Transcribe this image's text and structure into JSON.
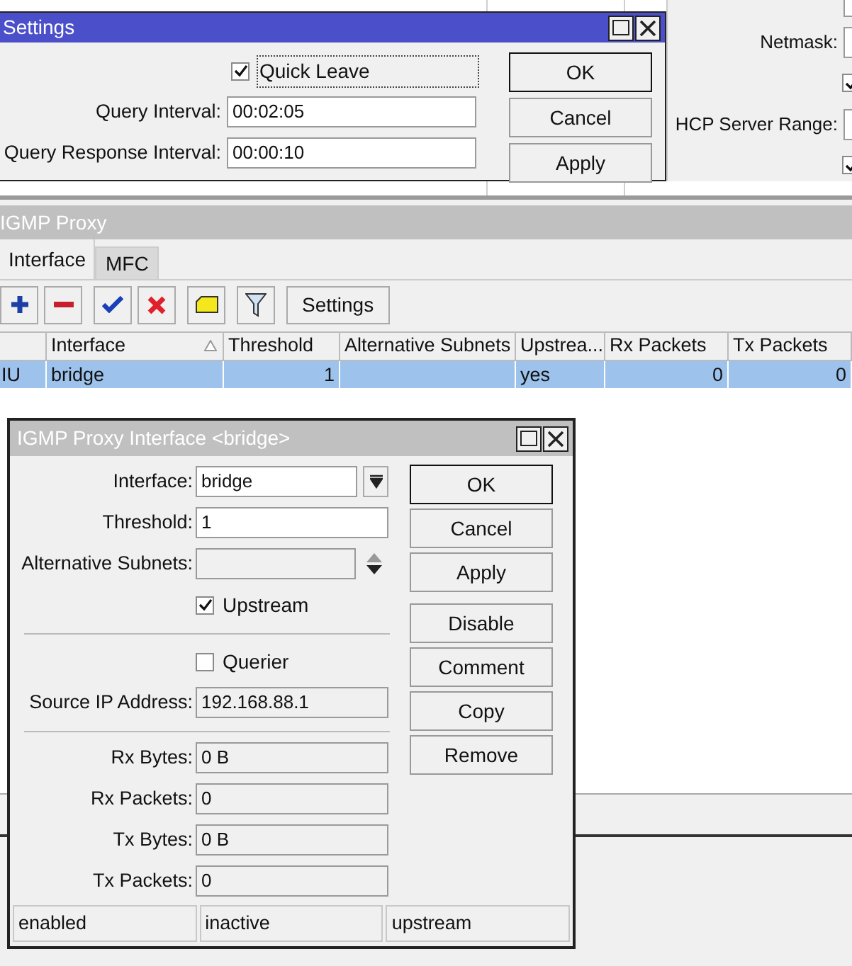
{
  "background_window": {
    "fields": [
      {
        "kind": "field"
      },
      {
        "label": "Netmask:"
      },
      {
        "kind": "checkbox",
        "checked": true
      },
      {
        "label": "HCP Server Range:"
      },
      {
        "kind": "checkbox",
        "checked": true
      }
    ]
  },
  "settings_window": {
    "title": "Settings",
    "quick_leave": {
      "label": "Quick Leave",
      "checked": true
    },
    "fields": [
      {
        "label": "Query Interval:",
        "value": "00:02:05"
      },
      {
        "label": "Query Response Interval:",
        "value": "00:00:10"
      }
    ],
    "buttons": [
      "OK",
      "Cancel",
      "Apply"
    ]
  },
  "igmp_proxy_window": {
    "title": "IGMP Proxy",
    "tabs": [
      {
        "label": "Interface",
        "selected": true
      },
      {
        "label": "MFC",
        "selected": false
      }
    ],
    "toolbar": [
      {
        "kind": "add"
      },
      {
        "kind": "remove"
      },
      {
        "kind": "enable"
      },
      {
        "kind": "disable"
      },
      {
        "kind": "comment"
      },
      {
        "kind": "filter"
      },
      {
        "kind": "text",
        "label": "Settings"
      }
    ],
    "table": {
      "columns": [
        {
          "label": "Interface",
          "sorted": true
        },
        {
          "label": "Threshold",
          "sorted": false
        },
        {
          "label": "Alternative Subnets",
          "sorted": false
        },
        {
          "label": "Upstrea...",
          "sorted": false
        },
        {
          "label": "Rx Packets",
          "sorted": false
        },
        {
          "label": "Tx Packets",
          "sorted": false
        }
      ],
      "rows": [
        {
          "selected": true,
          "flags": "IU",
          "interface": "bridge",
          "threshold": "1",
          "upstream": "yes",
          "rx_packets": "0",
          "tx_packets": "0"
        }
      ]
    }
  },
  "interface_dialog": {
    "title": "IGMP Proxy Interface <bridge>",
    "interface": {
      "label": "Interface:",
      "value": "bridge"
    },
    "threshold": {
      "label": "Threshold:",
      "value": "1"
    },
    "alternative_subnets": {
      "label": "Alternative Subnets:",
      "disabled": true
    },
    "upstream": {
      "label": "Upstream",
      "checked": true
    },
    "querier": {
      "label": "Querier",
      "checked": false
    },
    "source_ip": {
      "label": "Source IP Address:",
      "value": "192.168.88.1"
    },
    "stats": [
      {
        "label": "Rx Bytes:",
        "value": "0 B"
      },
      {
        "label": "Rx Packets:",
        "value": "0"
      },
      {
        "label": "Tx Bytes:",
        "value": "0 B"
      },
      {
        "label": "Tx Packets:",
        "value": "0"
      }
    ],
    "buttons": [
      {
        "label": "OK",
        "default": true
      },
      {
        "label": "Cancel",
        "default": false
      },
      {
        "label": "Apply",
        "default": false
      },
      {
        "label": "Disable",
        "default": false
      },
      {
        "label": "Comment",
        "default": false
      },
      {
        "label": "Copy",
        "default": false
      },
      {
        "label": "Remove",
        "default": false
      }
    ],
    "status": [
      "enabled",
      "inactive",
      "upstream"
    ]
  }
}
